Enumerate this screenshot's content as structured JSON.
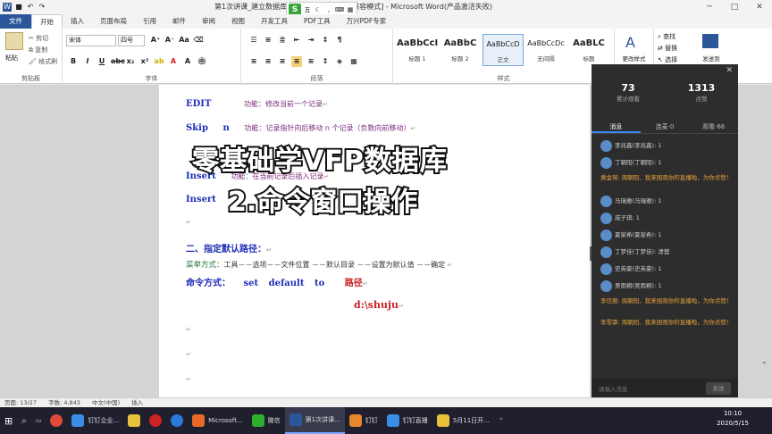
{
  "window": {
    "title": "第1次讲课_建立数据库  及导入数据源.doc [兼容模式] - Microsoft Word(产品激活失败)"
  },
  "tabs": [
    "文件",
    "开始",
    "插入",
    "页面布局",
    "引用",
    "邮件",
    "审阅",
    "视图",
    "开发工具",
    "PDF工具",
    "万兴PDF专家"
  ],
  "ribbon": {
    "clipboard": {
      "paste": "粘贴",
      "cut": "剪切",
      "copy": "复制",
      "format": "格式刷",
      "label": "剪贴板"
    },
    "font": {
      "name": "宋体",
      "size": "四号",
      "label": "字体"
    },
    "paragraph": {
      "label": "段落"
    },
    "styles": [
      {
        "preview": "AaBbCcI",
        "name": "标题 1"
      },
      {
        "preview": "AaBbC",
        "name": "标题 2"
      },
      {
        "preview": "AaBbCcD",
        "name": "正文"
      },
      {
        "preview": "AaBbCcDc",
        "name": "无间隔"
      },
      {
        "preview": "AaBLC",
        "name": "标题"
      }
    ],
    "styles_label": "样式",
    "change_styles": "更改样式",
    "edit": {
      "find": "查找",
      "replace": "替换",
      "select": "选择"
    },
    "send": "发送到"
  },
  "ime": {
    "logo": "S",
    "mode": "五"
  },
  "doc": {
    "l1_kw": "EDIT",
    "l1_desc": "功能：修改当前一个记录",
    "l2_kw": "Skip",
    "l2_n": "n",
    "l2_desc": "功能：记录指针向后移动 n 个记录（负数向前移动）",
    "l3_kw": "Insert",
    "l3_desc": "功能：在当前记录后插入记录",
    "l4_kw": "Insert",
    "h2": "二、指定默认路径：",
    "menu_label": "菜单方式：",
    "menu_text": "工具－－选项－－文件位置  －－默认目录  －－设置为默认值  －－确定",
    "cmd_label": "命令方式：",
    "cmd_text": "set  default  to",
    "cmd_path": "路径",
    "path": "d:\\shuju"
  },
  "overlay": {
    "line1": "零基础学VFP数据库",
    "line2": "2.命令窗口操作"
  },
  "live": {
    "views": "73",
    "views_label": "累计观看",
    "likes": "1313",
    "likes_label": "点赞",
    "tabs": [
      "消息",
      "连麦·0",
      "观看·66"
    ],
    "messages": [
      {
        "type": "user",
        "text": "李兆鑫(李兆鑫): 1"
      },
      {
        "type": "user",
        "text": "丁朝阳(丁朝阳): 1"
      },
      {
        "type": "sys",
        "text": "黄金琬: 周朝阳、我来围观你的直播啦，为你点赞！"
      },
      {
        "type": "user",
        "text": "马瑞雅(马瑞雅): 1"
      },
      {
        "type": "user",
        "text": "成子琪: 1"
      },
      {
        "type": "user",
        "text": "夏家希(夏家希): 1"
      },
      {
        "type": "user",
        "text": "丁梦佳(丁梦佳): 清楚"
      },
      {
        "type": "user",
        "text": "史英豪(史英豪): 1"
      },
      {
        "type": "user",
        "text": "吴雨桐(吴雨桐): 1"
      },
      {
        "type": "sys",
        "text": "李信丽: 周朝阳、我来围观你的直播啦，为你点赞！"
      },
      {
        "type": "sys",
        "text": "李雪霏: 周朝阳、我来围观你的直播啦，为你点赞！"
      }
    ],
    "input_placeholder": "请输入消息",
    "send": "发送"
  },
  "status": {
    "page": "页面: 13/27",
    "words": "字数: 4,843",
    "lang": "中文(中国)",
    "mode": "插入"
  },
  "taskbar": {
    "items": [
      "钉钉企业...",
      "Microsoft...",
      "微信",
      "第1次讲课...",
      "钉钉",
      "钉钉直播",
      "5月11日开..."
    ],
    "time": "10:10",
    "date": "2020/5/15"
  }
}
